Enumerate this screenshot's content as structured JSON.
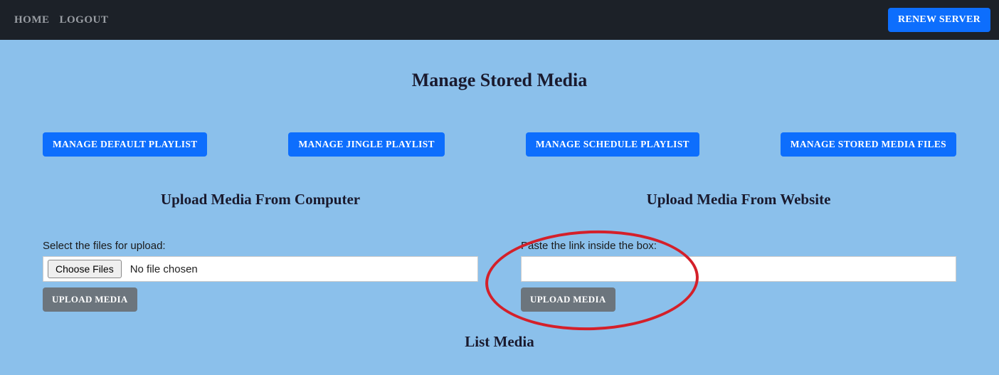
{
  "nav": {
    "home": "HOME",
    "logout": "LOGOUT",
    "renew": "RENEW SERVER"
  },
  "page": {
    "title": "Manage Stored Media"
  },
  "tabs": {
    "default": "MANAGE DEFAULT PLAYLIST",
    "jingle": "MANAGE JINGLE PLAYLIST",
    "schedule": "MANAGE SCHEDULE PLAYLIST",
    "stored": "MANAGE STORED MEDIA FILES"
  },
  "upload_computer": {
    "heading": "Upload Media From Computer",
    "label": "Select the files for upload:",
    "choose_btn": "Choose Files",
    "status": "No file chosen",
    "submit": "UPLOAD MEDIA"
  },
  "upload_website": {
    "heading": "Upload Media From Website",
    "label": "Paste the link inside the box:",
    "value": "",
    "submit": "UPLOAD MEDIA"
  },
  "list_media": {
    "heading": "List Media"
  }
}
